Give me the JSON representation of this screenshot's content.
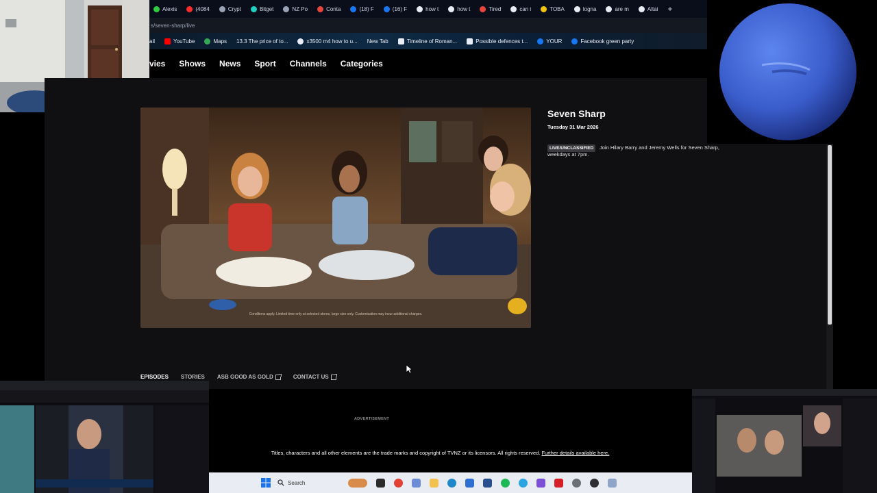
{
  "browser": {
    "tabs": [
      {
        "label": "Alexis",
        "color": "#2ecc40"
      },
      {
        "label": "(4084",
        "color": "#ff2a2a"
      },
      {
        "label": "Crypt",
        "color": "#9aa3b5"
      },
      {
        "label": "Bitget",
        "color": "#1fd1c1"
      },
      {
        "label": "NZ Po",
        "color": "#9aa3b5"
      },
      {
        "label": "Conta",
        "color": "#e8453c"
      },
      {
        "label": "(18) F",
        "color": "#1877f2"
      },
      {
        "label": "(16) F",
        "color": "#1877f2"
      },
      {
        "label": "how t",
        "color": "#e8ecf4"
      },
      {
        "label": "how t",
        "color": "#e8ecf4"
      },
      {
        "label": "Tired",
        "color": "#e8453c"
      },
      {
        "label": "can i",
        "color": "#e8ecf4"
      },
      {
        "label": "TOBA",
        "color": "#f2c40f"
      },
      {
        "label": "logna",
        "color": "#e8ecf4"
      },
      {
        "label": "are m",
        "color": "#e8ecf4"
      },
      {
        "label": "Altai",
        "color": "#e8ecf4"
      }
    ],
    "new_tab_symbol": "+",
    "url": "s/seven-sharp/live",
    "bookmarks": [
      {
        "label": "ail",
        "color": ""
      },
      {
        "label": "YouTube",
        "color": "#ff0000"
      },
      {
        "label": "Maps",
        "color": "#34a853"
      },
      {
        "label": "13.3 The price of to...",
        "color": ""
      },
      {
        "label": "x3500 m4 how to u...",
        "color": "#e8ecf4"
      },
      {
        "label": "New Tab",
        "color": ""
      },
      {
        "label": "Timeline of Roman...",
        "color": "#e8ecf4"
      },
      {
        "label": "Possible defences t...",
        "color": "#e8ecf4"
      },
      {
        "label": "YOUR",
        "color": "#1877f2"
      },
      {
        "label": "Facebook green party",
        "color": "#1877f2"
      }
    ]
  },
  "site_nav": {
    "items": [
      "vies",
      "Shows",
      "News",
      "Sport",
      "Channels",
      "Categories"
    ]
  },
  "video": {
    "caption": "Conditions apply. Limited time only at selected stores, large size only. Customisation may incur additional charges."
  },
  "show": {
    "title": "Seven Sharp",
    "date": "Tuesday 31 Mar 2026",
    "badge": "LIVE/UNCLASSIFIED",
    "description": "Join Hilary Barry and Jeremy Wells for Seven Sharp, weekdays at 7pm."
  },
  "page_tabs": [
    {
      "label": "EPISODES",
      "external": false,
      "active": true
    },
    {
      "label": "STORIES",
      "external": false,
      "active": false
    },
    {
      "label": "ASB GOOD AS GOLD",
      "external": true,
      "active": false
    },
    {
      "label": "CONTACT US",
      "external": true,
      "active": false
    }
  ],
  "footer": {
    "advertisement": "ADVERTISEMENT",
    "copyright": "Titles, characters and all other elements are the trade marks and copyright of TVNZ or its licensors. All rights reserved.",
    "link": "Further details available here."
  },
  "taskbar": {
    "search_label": "Search"
  },
  "colors": {
    "page_bg": "#101012",
    "taskbar_bg": "#e9edf3",
    "planet_blue": "#3f63d8"
  }
}
